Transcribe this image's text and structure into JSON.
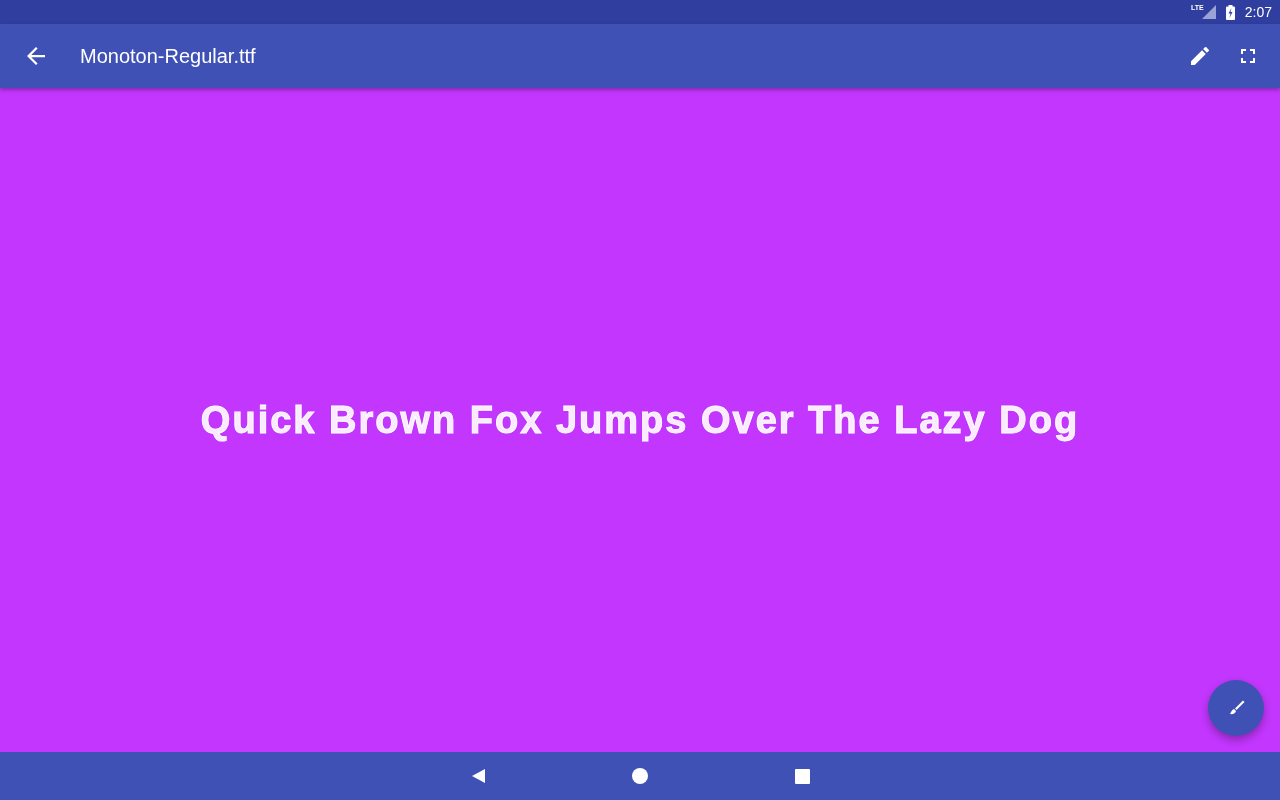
{
  "status_bar": {
    "network": "LTE",
    "time": "2:07"
  },
  "toolbar": {
    "title": "Monoton-Regular.ttf"
  },
  "preview": {
    "text": "Quick Brown Fox Jumps Over The Lazy Dog"
  }
}
